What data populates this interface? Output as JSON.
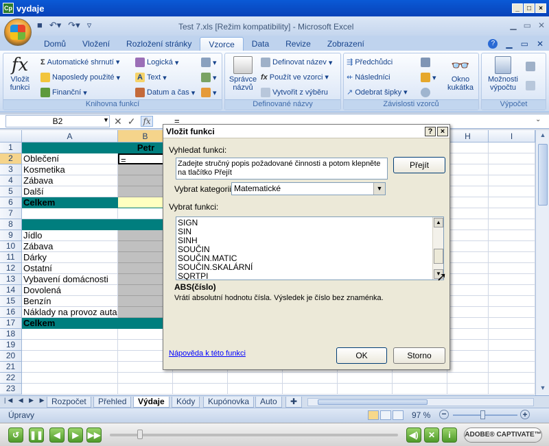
{
  "window": {
    "app_icon": "Cp",
    "title": "vydaje",
    "min": "_",
    "max": "□",
    "close": "×"
  },
  "excel": {
    "title": "Test 7.xls  [Režim kompatibility] - Microsoft Excel"
  },
  "tabs": [
    "Domů",
    "Vložení",
    "Rozložení stránky",
    "Vzorce",
    "Data",
    "Revize",
    "Zobrazení"
  ],
  "active_tab": "Vzorce",
  "ribbon": {
    "insert_function": {
      "symbol": "fx",
      "label1": "Vložit",
      "label2": "funkci"
    },
    "lib": {
      "autosum": "Automatické shrnutí",
      "recent": "Naposledy použité",
      "financial": "Finanční",
      "logical": "Logická",
      "text": "Text",
      "datetime": "Datum a čas",
      "label": "Knihovna funkcí"
    },
    "names": {
      "manager1": "Správce",
      "manager2": "názvů",
      "define": "Definovat název",
      "use": "Použít ve vzorci",
      "create": "Vytvořit z výběru",
      "label": "Definované názvy"
    },
    "audit": {
      "precedents": "Předchůdci",
      "dependents": "Následníci",
      "remove": "Odebrat šipky",
      "watch1": "Okno",
      "watch2": "kukátka",
      "label": "Závislosti vzorců"
    },
    "calc": {
      "options1": "Možnosti",
      "options2": "výpočtu",
      "label": "Výpočet"
    }
  },
  "formula_bar": {
    "name_box": "B2",
    "fx": "fx",
    "content": "="
  },
  "columns": [
    "A",
    "B",
    "C",
    "D",
    "E",
    "F",
    "G",
    "H",
    "I"
  ],
  "rows": [
    "1",
    "2",
    "3",
    "4",
    "5",
    "6",
    "7",
    "8",
    "9",
    "10",
    "11",
    "12",
    "13",
    "14",
    "15",
    "16",
    "17",
    "18",
    "19",
    "20",
    "21",
    "22",
    "23"
  ],
  "cells": {
    "b1": "Petr",
    "a2": "Oblečení",
    "b2": "=",
    "a3": "Kosmetika",
    "a4": "Zábava",
    "a5": "Další",
    "a6": "Celkem",
    "a9": "Jídlo",
    "a10": "Zábava",
    "a11": "Dárky",
    "a12": "Ostatní",
    "a13": "Vybavení domácnosti",
    "a14": "Dovolená",
    "a15": "Benzín",
    "a16": "Náklady na provoz auta",
    "a17": "Celkem"
  },
  "dialog": {
    "title": "Vložit funkci",
    "help_btn": "?",
    "close_btn": "×",
    "search_label": "Vyhledat funkci:",
    "search_value": "Zadejte stručný popis požadované činnosti a potom klepněte na tlačítko Přejít",
    "go": "Přejít",
    "category_label": "Vybrat kategorii:",
    "category_value": "Matematické",
    "function_label": "Vybrat funkci:",
    "functions": [
      "SIGN",
      "SIN",
      "SINH",
      "SOUČIN",
      "SOUČIN.MATIC",
      "SOUČIN.SKALÁRNÍ",
      "SQRTPI"
    ],
    "signature": "ABS(číslo)",
    "description": "Vrátí absolutní hodnotu čísla. Výsledek je číslo bez znaménka.",
    "help_link": "Nápověda k této funkci",
    "ok": "OK",
    "cancel": "Storno"
  },
  "sheets": [
    "Rozpočet",
    "Přehled",
    "Výdaje",
    "Kódy",
    "Kupónovka",
    "Auto"
  ],
  "active_sheet": "Výdaje",
  "status": {
    "mode": "Úpravy",
    "zoom": "97 %"
  },
  "captivate": {
    "brand": "ADOBE® CAPTIVATE™"
  },
  "colors": {
    "teal": "#007e7e",
    "gray": "#c0c0c0",
    "yellow": "#ffffc0",
    "ribbon_text": "#15428b"
  }
}
